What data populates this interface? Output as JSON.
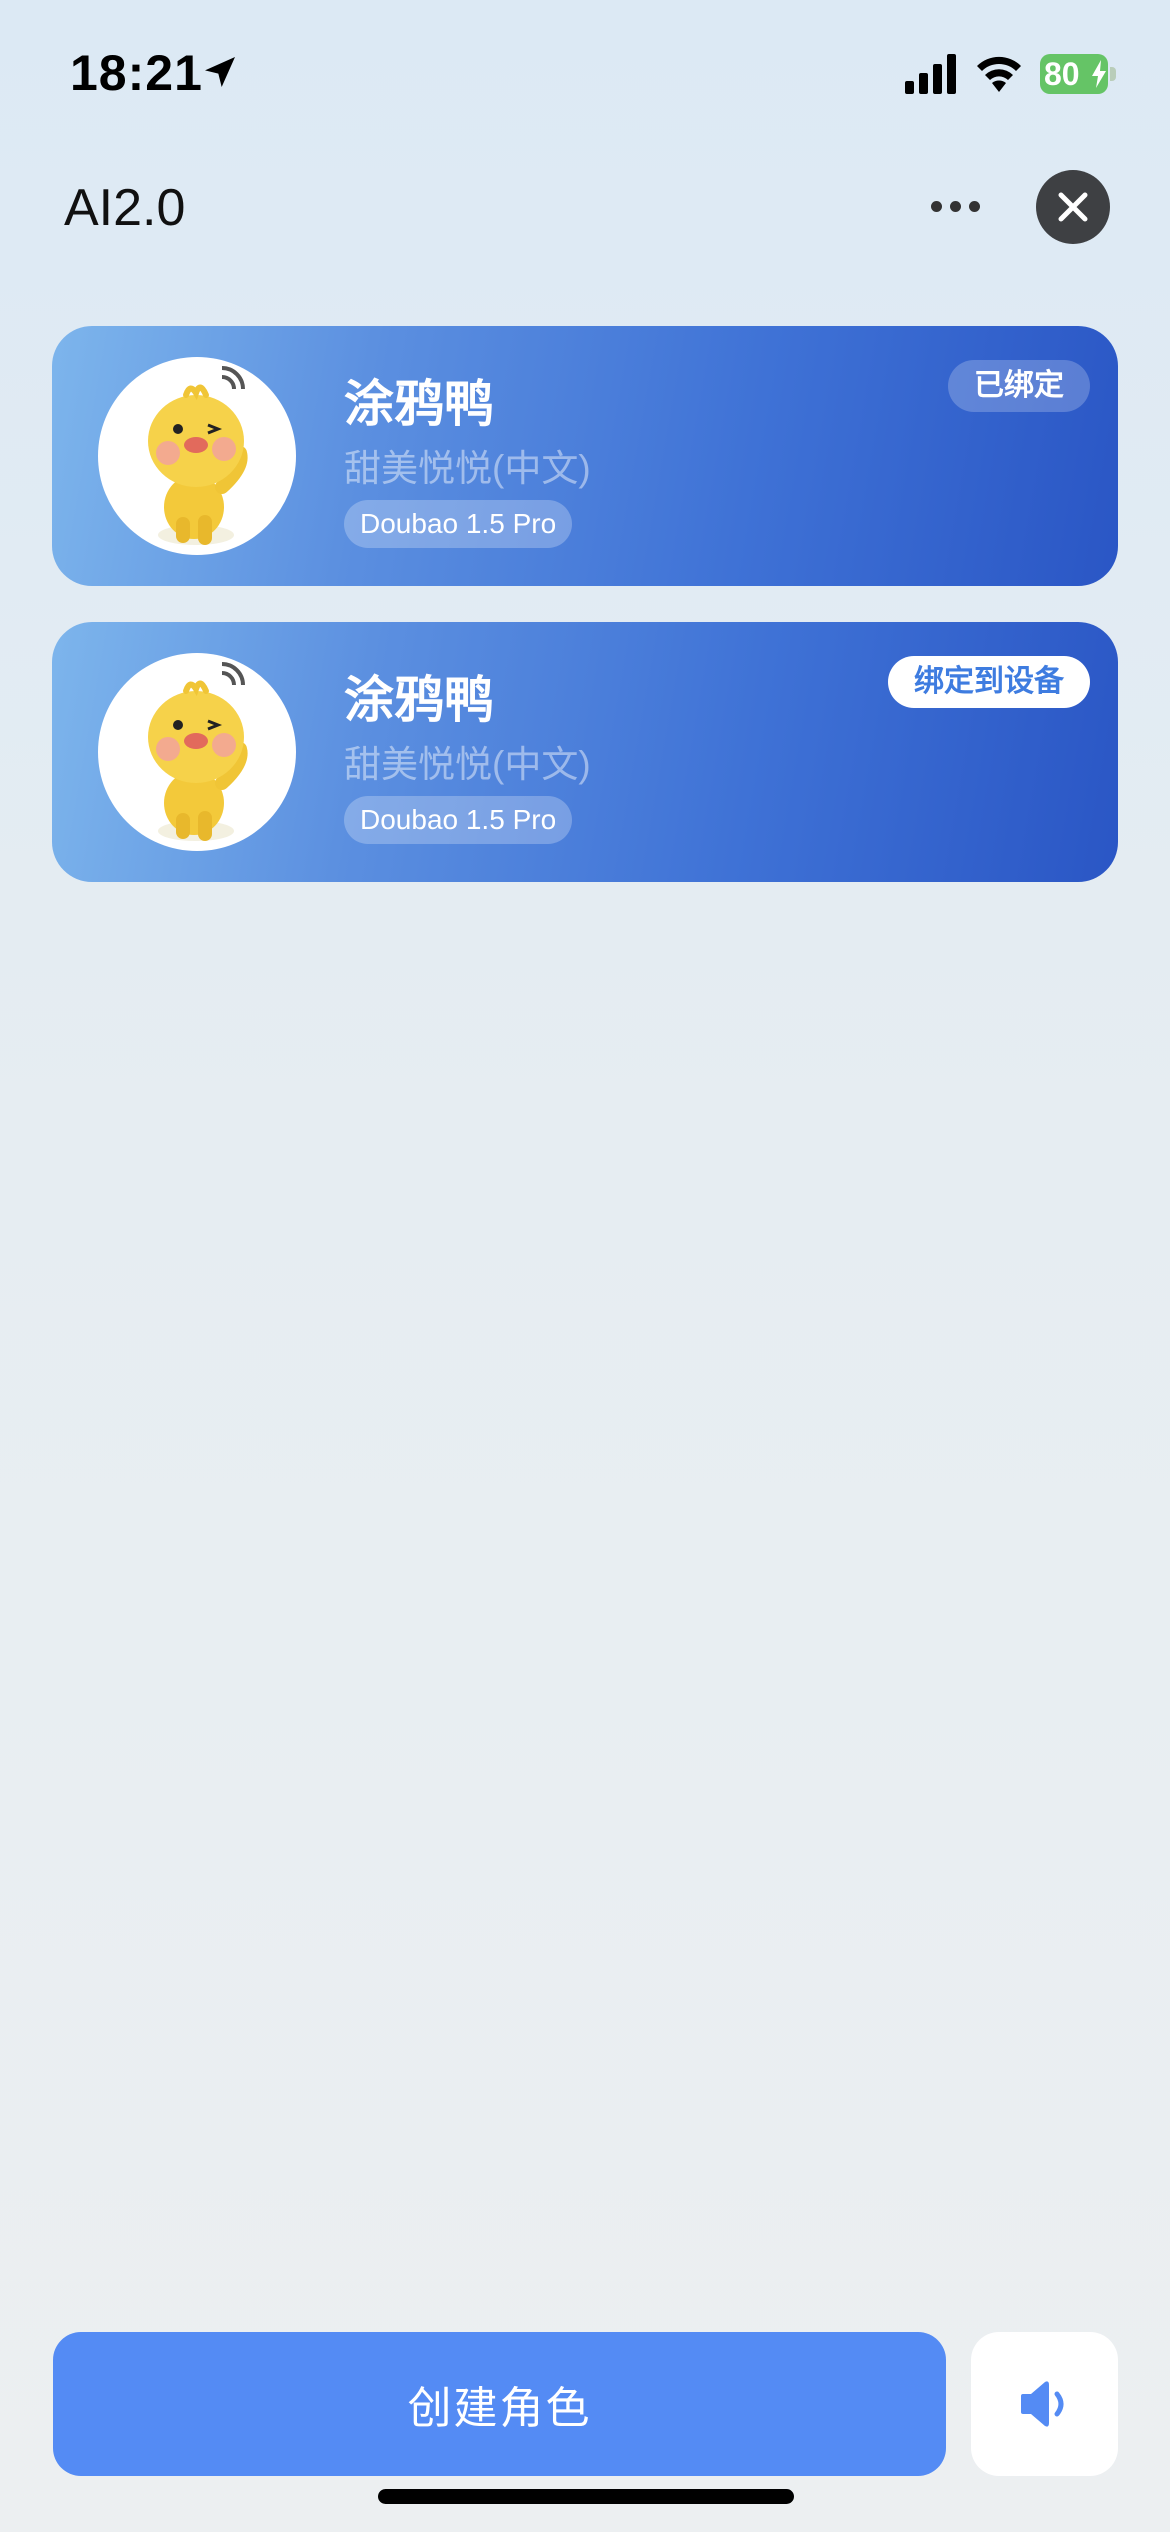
{
  "status_bar": {
    "time": "18:21",
    "battery_level": "80",
    "icons": [
      "location-arrow-icon",
      "cellular-signal-icon",
      "wifi-icon",
      "battery-charging-icon"
    ]
  },
  "header": {
    "title": "AI2.0",
    "more_icon": "ellipsis-icon",
    "close_icon": "close-icon"
  },
  "characters": [
    {
      "name": "涂鸦鸭",
      "voice": "甜美悦悦(中文)",
      "model": "Doubao 1.5 Pro",
      "status_label": "已绑定",
      "bound": true
    },
    {
      "name": "涂鸦鸭",
      "voice": "甜美悦悦(中文)",
      "model": "Doubao 1.5 Pro",
      "status_label": "绑定到设备",
      "bound": false
    }
  ],
  "footer": {
    "create_label": "创建角色",
    "speaker_icon": "speaker-icon"
  },
  "colors": {
    "primary": "#548bf4",
    "card_start": "#7db5ec",
    "card_end": "#2a56c5",
    "battery": "#65c466"
  }
}
